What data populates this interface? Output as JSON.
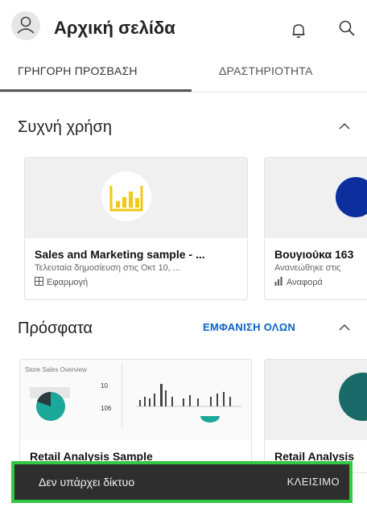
{
  "header": {
    "title": "Αρχική σελίδα",
    "avatar_icon": "person-icon",
    "notifications_icon": "bell-icon",
    "search_icon": "search-icon"
  },
  "tabs": [
    {
      "label": "ΓΡΗΓΟΡΗ ΠΡΟΣΒΑΣΗ",
      "selected": true
    },
    {
      "label": "ΔΡΑΣΤΗΡΙΟΤΗΤΑ",
      "selected": false
    }
  ],
  "frequent": {
    "title": "Συχνή χρήση",
    "cards": [
      {
        "title": "Sales and Marketing sample - ...",
        "subtitle": "Τελευταία δημοσίευση στις Οκτ 10, ...",
        "type_label": "Εφαρμογή",
        "type_icon": "app-icon"
      },
      {
        "title": "Βουγιούκα 163",
        "subtitle": "Ανανεώθηκε στις",
        "type_label": "Αναφορά",
        "type_icon": "report-icon"
      }
    ]
  },
  "recent": {
    "title": "Πρόσφατα",
    "see_all": "ΕΜΦΑΝΙΣΗ ΟΛΩΝ",
    "thumbnail": {
      "title": "Store Sales Overview",
      "kpi1": "10",
      "kpi2": "106"
    },
    "cards": [
      {
        "title": "Retail Analysis Sample"
      },
      {
        "title": "Retail Analysis"
      }
    ]
  },
  "snackbar": {
    "message": "Δεν υπάρχει δίκτυο",
    "action": "ΚΛΕΙΣΙΜΟ"
  },
  "colors": {
    "accent": "#0a63c7",
    "snackbar_bg": "#2e2e2e",
    "highlight_border": "#32c842",
    "powerbi_yellow": "#f2c811"
  }
}
